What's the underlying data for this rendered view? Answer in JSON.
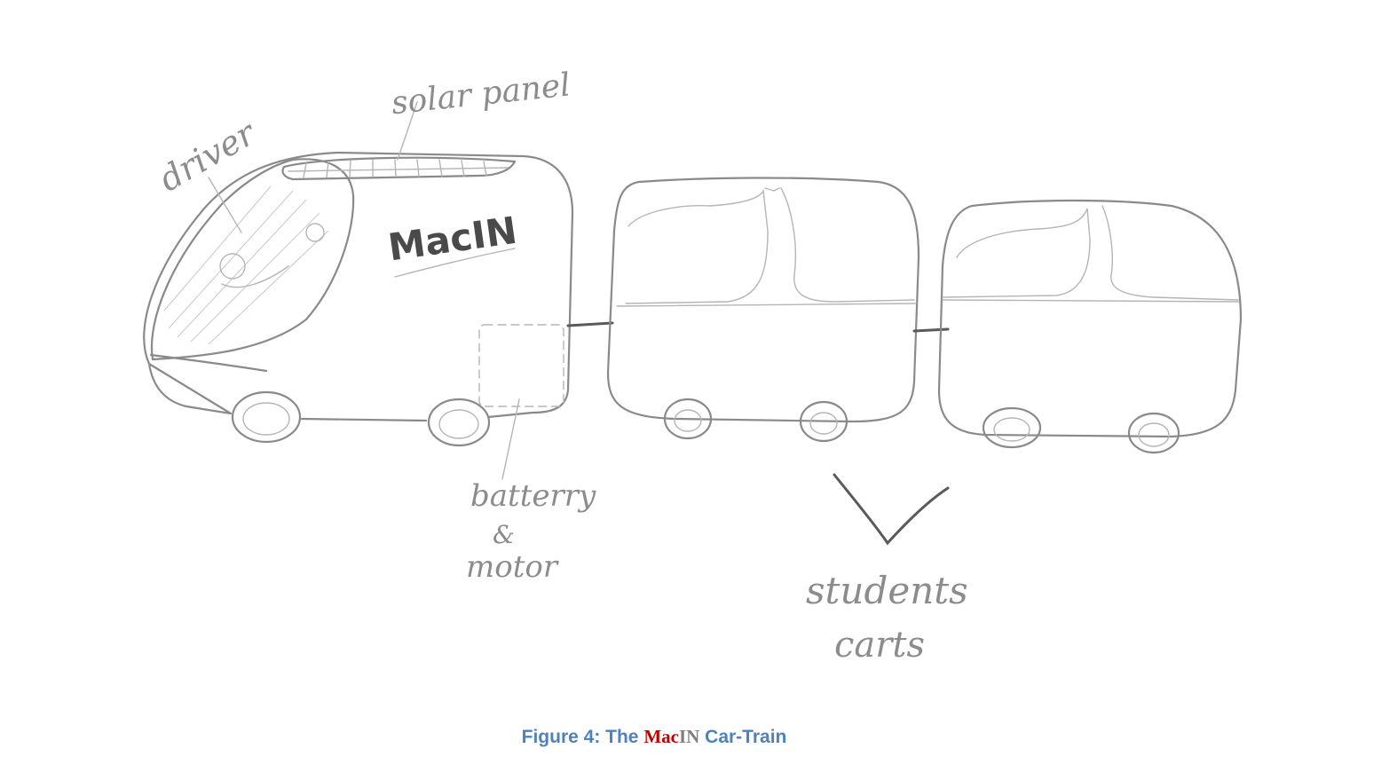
{
  "figure": {
    "labels": {
      "driver": "driver",
      "solar_panel": "solar panel",
      "battery_line1": "batterry",
      "battery_line2": "&",
      "battery_line3": "motor",
      "students_line1": "students",
      "students_line2": "carts"
    },
    "vehicle_logo": "MacIN",
    "caption": {
      "prefix": "Figure 4: The ",
      "mac": "Mac",
      "in": "IN",
      "suffix": " Car-Train"
    }
  }
}
